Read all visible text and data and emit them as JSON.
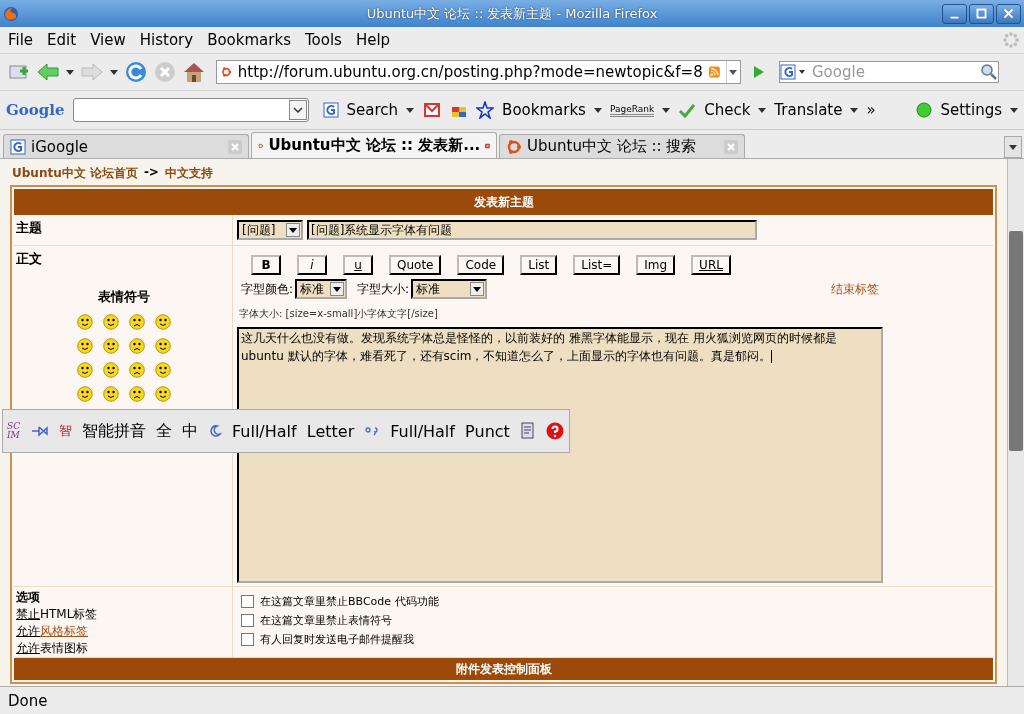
{
  "window": {
    "title": "Ubuntu中文 论坛 :: 发表新主题 - Mozilla Firefox"
  },
  "menu": [
    "File",
    "Edit",
    "View",
    "History",
    "Bookmarks",
    "Tools",
    "Help"
  ],
  "address": {
    "value": "http://forum.ubuntu.org.cn/posting.php?mode=newtopic&f=8"
  },
  "search": {
    "placeholder": "Google"
  },
  "google_toolbar": {
    "logo": "Google",
    "search": "Search",
    "bookmarks": "Bookmarks",
    "pagerank": "PageRank",
    "check": "Check",
    "translate": "Translate",
    "more": "»",
    "settings": "Settings"
  },
  "tabs": [
    {
      "label": "iGoogle",
      "selected": false,
      "kind": "google"
    },
    {
      "label": "Ubuntu中文 论坛 :: 发表新...",
      "selected": true,
      "kind": "ubuntu"
    },
    {
      "label": "Ubuntu中文 论坛 :: 搜索",
      "selected": false,
      "kind": "ubuntu"
    }
  ],
  "breadcrumb": {
    "home": "Ubuntu中文 论坛首页",
    "sep": "->",
    "forum": "中文支持"
  },
  "form": {
    "heading": "发表新主题",
    "subject_label": "主题",
    "topic_type": "[问题]",
    "subject": "[问题]系统显示字体有问题",
    "body_label": "正文",
    "emoticons_title": "表情符号",
    "format_buttons": [
      "B",
      "i",
      "u",
      "Quote",
      "Code",
      "List",
      "List=",
      "Img",
      "URL"
    ],
    "color_label": "字型颜色:",
    "color_value": "标准",
    "size_label": "字型大小:",
    "size_value": "标准",
    "close_tags": "结束标签",
    "hint": "字体大小: [size=x-small]小字体文字[/size]",
    "message": "这几天什么也没有做。发现系统字体总是怪怪的，以前装好的 雅黑字体能显示，现在 用火狐浏览网页的时候都是 ubuntu 默认的字体，难看死了，还有scim，不知道怎么了，上面显示的字体也有问题。真是郁闷。",
    "options_title": "选项",
    "option_notes": [
      {
        "prefix": "禁止",
        "rest": "HTML标签",
        "link": false
      },
      {
        "prefix": "允许",
        "rest": "风格标签",
        "link": true
      },
      {
        "prefix": "允许",
        "rest": "表情图标",
        "link": false
      }
    ],
    "options": [
      {
        "label": "在这篇文章里禁止BBCode 代码功能",
        "checked": false
      },
      {
        "label": "在这篇文章里禁止表情符号",
        "checked": false
      },
      {
        "label": "有人回复时发送电子邮件提醒我",
        "checked": false
      }
    ],
    "attach_heading": "附件发表控制面板"
  },
  "scim": {
    "logo": "SC IM",
    "mode_icon": "智",
    "input_method": "智能拼音",
    "width": "全",
    "lang": "中",
    "letter": "Full/Half  Letter",
    "punct": "Full/Half  Punct"
  },
  "status_bar": "Done"
}
